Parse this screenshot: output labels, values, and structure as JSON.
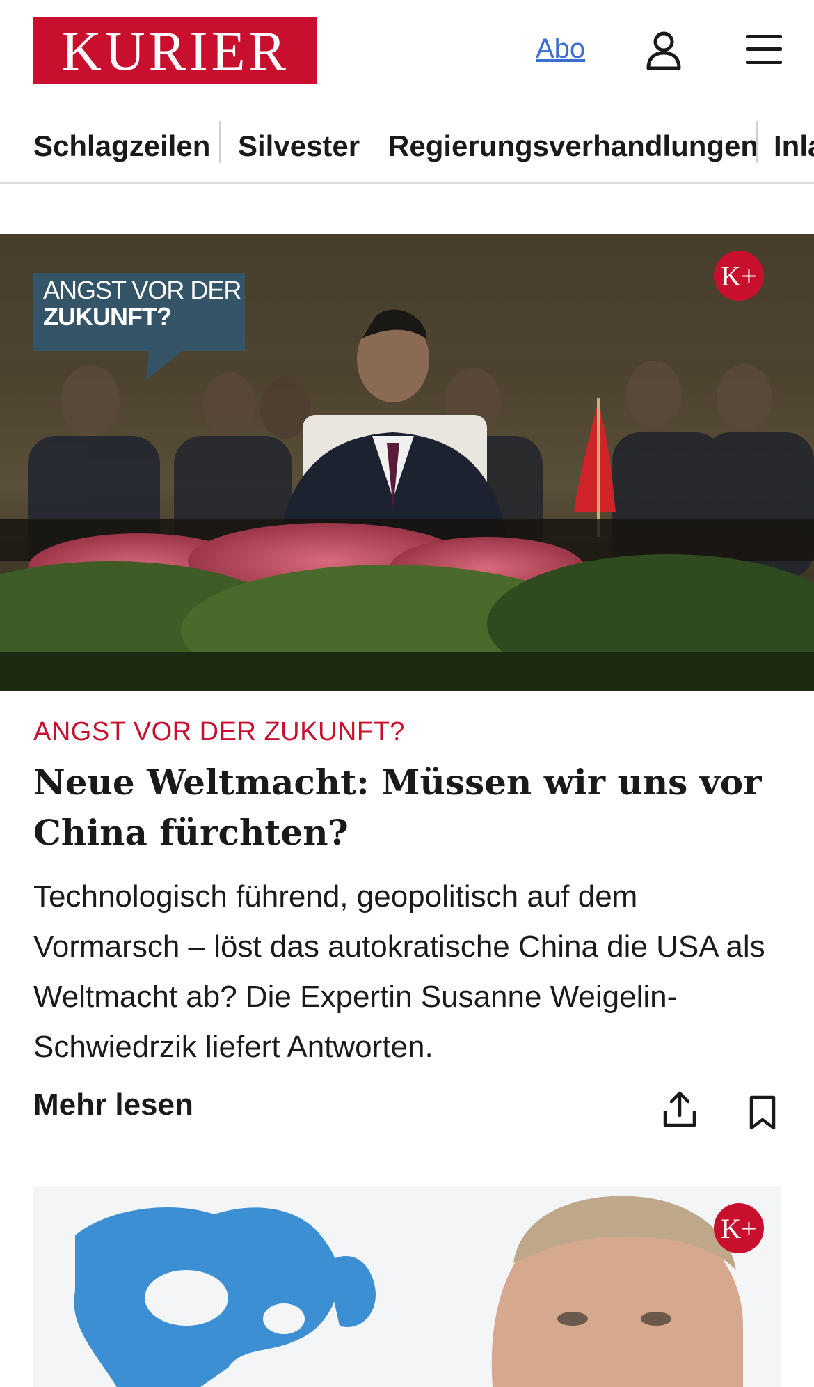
{
  "header": {
    "logo_text": "KURIER",
    "abo_label": "Abo",
    "user_icon": "user-icon",
    "menu_icon": "hamburger-menu-icon"
  },
  "nav": {
    "items": [
      {
        "label": "Schlagzeilen"
      },
      {
        "label": "Silvester"
      },
      {
        "label": "Regierungsverhandlungen"
      },
      {
        "label": "Inla"
      }
    ]
  },
  "article1": {
    "image_overlay_line1": "ANGST VOR DER",
    "image_overlay_line2": "ZUKUNFT?",
    "premium_badge": "K+",
    "kicker": "ANGST VOR DER ZUKUNFT?",
    "headline": "Neue Weltmacht: Müssen wir uns vor China fürchten?",
    "teaser": "Technologisch führend, geopolitisch auf dem Vormarsch – löst das autokratische China die USA als Weltmacht ab? Die Expertin Susanne Weigelin-Schwiedrzik liefert Antworten.",
    "more_label": "Mehr lesen"
  },
  "article2": {
    "premium_badge": "K+"
  },
  "colors": {
    "brand_red": "#c8102e",
    "link_blue": "#3a6fd1"
  }
}
